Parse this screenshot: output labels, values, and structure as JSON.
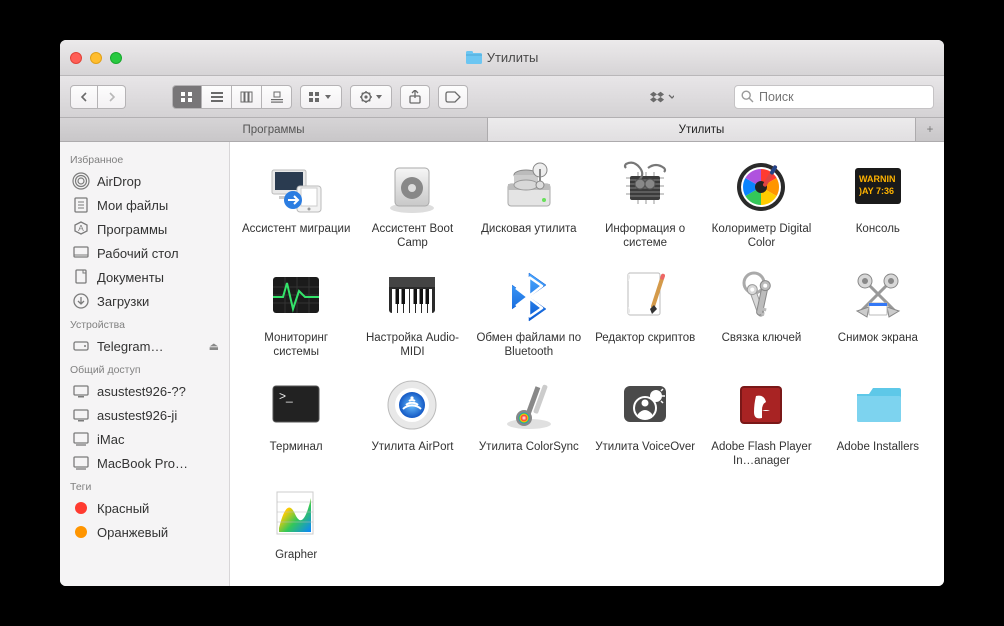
{
  "window": {
    "title": "Утилиты",
    "folder_icon": "utilities-folder"
  },
  "toolbar": {
    "search_placeholder": "Поиск"
  },
  "tabs": [
    {
      "label": "Программы",
      "active": false
    },
    {
      "label": "Утилиты",
      "active": true
    }
  ],
  "sidebar": {
    "sections": [
      {
        "header": "Избранное",
        "items": [
          {
            "icon": "airdrop-icon",
            "label": "AirDrop"
          },
          {
            "icon": "myfiles-icon",
            "label": "Мои файлы"
          },
          {
            "icon": "apps-icon",
            "label": "Программы"
          },
          {
            "icon": "desktop-icon",
            "label": "Рабочий стол"
          },
          {
            "icon": "documents-icon",
            "label": "Документы"
          },
          {
            "icon": "downloads-icon",
            "label": "Загрузки"
          }
        ]
      },
      {
        "header": "Устройства",
        "items": [
          {
            "icon": "disk-icon",
            "label": "Telegram…",
            "eject": true
          }
        ]
      },
      {
        "header": "Общий доступ",
        "items": [
          {
            "icon": "pc-icon",
            "label": "asustest926-??"
          },
          {
            "icon": "pc-icon",
            "label": "asustest926-ji"
          },
          {
            "icon": "mac-icon",
            "label": "iMac"
          },
          {
            "icon": "mac-icon",
            "label": "MacBook Pro…"
          }
        ]
      },
      {
        "header": "Теги",
        "items": [
          {
            "icon": "tag-dot",
            "color": "#ff3b30",
            "label": "Красный"
          },
          {
            "icon": "tag-dot",
            "color": "#ff9500",
            "label": "Оранжевый"
          }
        ]
      }
    ]
  },
  "files": [
    {
      "id": "migration",
      "label": "Ассистент миграции"
    },
    {
      "id": "bootcamp",
      "label": "Ассистент Boot Camp"
    },
    {
      "id": "diskutil",
      "label": "Дисковая утилита"
    },
    {
      "id": "sysinfo",
      "label": "Информация о системе"
    },
    {
      "id": "colormeter",
      "label": "Колориметр Digital Color"
    },
    {
      "id": "console",
      "label": "Консоль"
    },
    {
      "id": "activity",
      "label": "Мониторинг системы"
    },
    {
      "id": "audiomidi",
      "label": "Настройка Audio-MIDI"
    },
    {
      "id": "bluetooth",
      "label": "Обмен файлами по Bluetooth"
    },
    {
      "id": "scripted",
      "label": "Редактор скриптов"
    },
    {
      "id": "keychain",
      "label": "Связка ключей"
    },
    {
      "id": "screenshot",
      "label": "Снимок экрана"
    },
    {
      "id": "terminal",
      "label": "Терминал"
    },
    {
      "id": "airport",
      "label": "Утилита AirPort"
    },
    {
      "id": "colorsync",
      "label": "Утилита ColorSync"
    },
    {
      "id": "voiceover",
      "label": "Утилита VoiceOver"
    },
    {
      "id": "flash",
      "label": "Adobe Flash Player In…anager"
    },
    {
      "id": "adobeinst",
      "label": "Adobe Installers"
    },
    {
      "id": "grapher",
      "label": "Grapher"
    }
  ]
}
